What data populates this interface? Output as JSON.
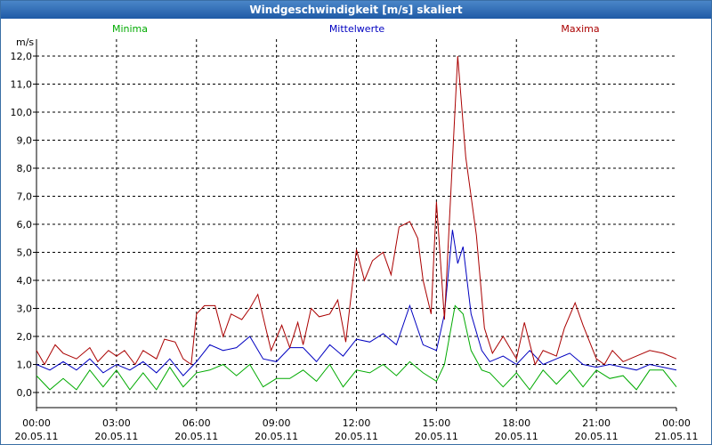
{
  "window": {
    "title": "Windgeschwindigkeit [m/s] skaliert"
  },
  "chart_data": {
    "type": "line",
    "title": "Windgeschwindigkeit [m/s] skaliert",
    "ylabel": "m/s",
    "ylim": [
      0,
      12.5
    ],
    "xlim_hours": [
      0,
      24
    ],
    "grid": true,
    "y_ticks": [
      "0,0",
      "1,0",
      "2,0",
      "3,0",
      "4,0",
      "5,0",
      "6,0",
      "7,0",
      "8,0",
      "9,0",
      "10,0",
      "11,0",
      "12,0"
    ],
    "x_ticks": [
      {
        "time": "00:00",
        "date": "20.05.11"
      },
      {
        "time": "03:00",
        "date": "20.05.11"
      },
      {
        "time": "06:00",
        "date": "20.05.11"
      },
      {
        "time": "09:00",
        "date": "20.05.11"
      },
      {
        "time": "12:00",
        "date": "20.05.11"
      },
      {
        "time": "15:00",
        "date": "20.05.11"
      },
      {
        "time": "18:00",
        "date": "20.05.11"
      },
      {
        "time": "21:00",
        "date": "20.05.11"
      },
      {
        "time": "00:00",
        "date": "21.05.11"
      }
    ],
    "legend": {
      "position": "top"
    },
    "series": [
      {
        "name": "Minima",
        "color": "#00aa00",
        "points": [
          [
            0,
            0.6
          ],
          [
            0.5,
            0.1
          ],
          [
            1,
            0.5
          ],
          [
            1.5,
            0.1
          ],
          [
            2,
            0.8
          ],
          [
            2.5,
            0.2
          ],
          [
            3,
            0.8
          ],
          [
            3.5,
            0.1
          ],
          [
            4,
            0.7
          ],
          [
            4.5,
            0.1
          ],
          [
            5,
            0.9
          ],
          [
            5.5,
            0.2
          ],
          [
            6,
            0.7
          ],
          [
            6.5,
            0.8
          ],
          [
            7,
            1.0
          ],
          [
            7.5,
            0.6
          ],
          [
            8,
            1.0
          ],
          [
            8.5,
            0.2
          ],
          [
            9,
            0.5
          ],
          [
            9.5,
            0.5
          ],
          [
            10,
            0.8
          ],
          [
            10.5,
            0.4
          ],
          [
            11,
            1.0
          ],
          [
            11.5,
            0.2
          ],
          [
            12,
            0.8
          ],
          [
            12.5,
            0.7
          ],
          [
            13,
            1.0
          ],
          [
            13.5,
            0.6
          ],
          [
            14,
            1.1
          ],
          [
            14.5,
            0.7
          ],
          [
            15,
            0.4
          ],
          [
            15.3,
            1.0
          ],
          [
            15.7,
            3.1
          ],
          [
            16,
            2.8
          ],
          [
            16.3,
            1.5
          ],
          [
            16.7,
            0.8
          ],
          [
            17,
            0.7
          ],
          [
            17.5,
            0.2
          ],
          [
            18,
            0.7
          ],
          [
            18.5,
            0.1
          ],
          [
            19,
            0.8
          ],
          [
            19.5,
            0.3
          ],
          [
            20,
            0.8
          ],
          [
            20.5,
            0.2
          ],
          [
            21,
            0.8
          ],
          [
            21.5,
            0.5
          ],
          [
            22,
            0.6
          ],
          [
            22.5,
            0.1
          ],
          [
            23,
            0.8
          ],
          [
            23.5,
            0.8
          ],
          [
            24,
            0.2
          ]
        ]
      },
      {
        "name": "Mittelwerte",
        "color": "#0000c0",
        "points": [
          [
            0,
            1.0
          ],
          [
            0.5,
            0.8
          ],
          [
            1,
            1.1
          ],
          [
            1.5,
            0.8
          ],
          [
            2,
            1.2
          ],
          [
            2.5,
            0.7
          ],
          [
            3,
            1.0
          ],
          [
            3.5,
            0.8
          ],
          [
            4,
            1.1
          ],
          [
            4.5,
            0.7
          ],
          [
            5,
            1.2
          ],
          [
            5.5,
            0.6
          ],
          [
            6,
            1.1
          ],
          [
            6.5,
            1.7
          ],
          [
            7,
            1.5
          ],
          [
            7.5,
            1.6
          ],
          [
            8,
            2.0
          ],
          [
            8.5,
            1.2
          ],
          [
            9,
            1.1
          ],
          [
            9.5,
            1.6
          ],
          [
            10,
            1.6
          ],
          [
            10.5,
            1.1
          ],
          [
            11,
            1.7
          ],
          [
            11.5,
            1.3
          ],
          [
            12,
            1.9
          ],
          [
            12.5,
            1.8
          ],
          [
            13,
            2.1
          ],
          [
            13.5,
            1.7
          ],
          [
            14,
            3.1
          ],
          [
            14.5,
            1.7
          ],
          [
            15,
            1.5
          ],
          [
            15.3,
            2.8
          ],
          [
            15.6,
            5.8
          ],
          [
            15.8,
            4.6
          ],
          [
            16,
            5.2
          ],
          [
            16.3,
            2.8
          ],
          [
            16.7,
            1.5
          ],
          [
            17,
            1.1
          ],
          [
            17.5,
            1.3
          ],
          [
            18,
            1.0
          ],
          [
            18.5,
            1.5
          ],
          [
            19,
            1.0
          ],
          [
            19.5,
            1.2
          ],
          [
            20,
            1.4
          ],
          [
            20.5,
            1.0
          ],
          [
            21,
            0.9
          ],
          [
            21.5,
            1.0
          ],
          [
            22,
            0.9
          ],
          [
            22.5,
            0.8
          ],
          [
            23,
            1.0
          ],
          [
            23.5,
            0.9
          ],
          [
            24,
            0.8
          ]
        ]
      },
      {
        "name": "Maxima",
        "color": "#aa0000",
        "points": [
          [
            0,
            1.5
          ],
          [
            0.3,
            1.0
          ],
          [
            0.7,
            1.7
          ],
          [
            1,
            1.4
          ],
          [
            1.5,
            1.2
          ],
          [
            2,
            1.6
          ],
          [
            2.3,
            1.1
          ],
          [
            2.7,
            1.5
          ],
          [
            3,
            1.3
          ],
          [
            3.3,
            1.5
          ],
          [
            3.7,
            1.0
          ],
          [
            4,
            1.5
          ],
          [
            4.5,
            1.2
          ],
          [
            4.8,
            1.9
          ],
          [
            5.2,
            1.8
          ],
          [
            5.5,
            1.2
          ],
          [
            5.8,
            1.0
          ],
          [
            6,
            2.8
          ],
          [
            6.3,
            3.1
          ],
          [
            6.7,
            3.1
          ],
          [
            7,
            2.0
          ],
          [
            7.3,
            2.8
          ],
          [
            7.7,
            2.6
          ],
          [
            8,
            3.0
          ],
          [
            8.3,
            3.5
          ],
          [
            8.6,
            2.3
          ],
          [
            8.8,
            1.5
          ],
          [
            9.2,
            2.4
          ],
          [
            9.5,
            1.6
          ],
          [
            9.8,
            2.5
          ],
          [
            10,
            1.7
          ],
          [
            10.3,
            3.0
          ],
          [
            10.6,
            2.7
          ],
          [
            11,
            2.8
          ],
          [
            11.3,
            3.3
          ],
          [
            11.6,
            1.8
          ],
          [
            12,
            5.1
          ],
          [
            12.3,
            4.0
          ],
          [
            12.6,
            4.7
          ],
          [
            13,
            5.0
          ],
          [
            13.3,
            4.2
          ],
          [
            13.6,
            5.9
          ],
          [
            14,
            6.1
          ],
          [
            14.3,
            5.5
          ],
          [
            14.5,
            4.0
          ],
          [
            14.8,
            2.8
          ],
          [
            15,
            6.8
          ],
          [
            15.3,
            2.6
          ],
          [
            15.6,
            8.3
          ],
          [
            15.8,
            12.0
          ],
          [
            16.1,
            8.4
          ],
          [
            16.5,
            5.6
          ],
          [
            16.8,
            2.3
          ],
          [
            17.1,
            1.4
          ],
          [
            17.5,
            2.0
          ],
          [
            18,
            1.2
          ],
          [
            18.3,
            2.5
          ],
          [
            18.7,
            1.0
          ],
          [
            19,
            1.5
          ],
          [
            19.5,
            1.3
          ],
          [
            19.8,
            2.3
          ],
          [
            20.2,
            3.2
          ],
          [
            20.5,
            2.4
          ],
          [
            21,
            1.2
          ],
          [
            21.3,
            1.0
          ],
          [
            21.6,
            1.5
          ],
          [
            22,
            1.1
          ],
          [
            22.5,
            1.3
          ],
          [
            23,
            1.5
          ],
          [
            23.5,
            1.4
          ],
          [
            24,
            1.2
          ]
        ]
      }
    ]
  }
}
